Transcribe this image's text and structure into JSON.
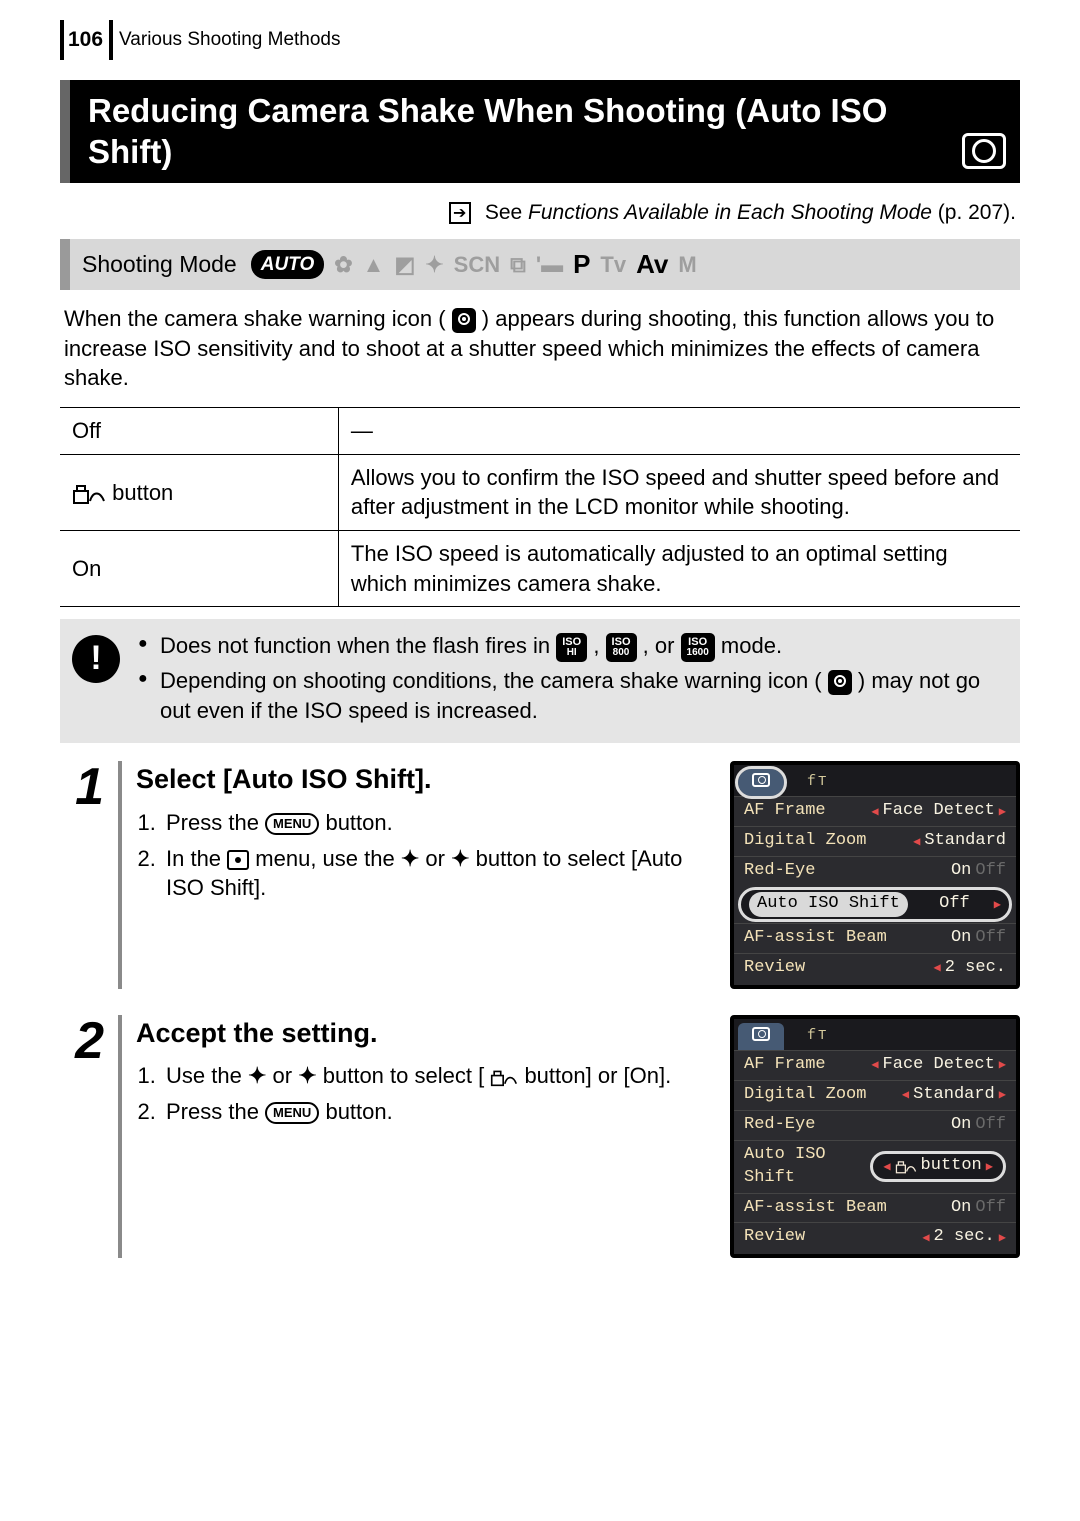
{
  "page": {
    "number": "106",
    "breadcrumb": "Various Shooting Methods"
  },
  "section": {
    "title": "Reducing Camera Shake When Shooting (Auto ISO Shift)"
  },
  "reference": {
    "prefix_plain": "See ",
    "link_text": "Functions Available in Each Shooting Mode",
    "page_ref": " (p. 207)."
  },
  "shooting_mode": {
    "label": "Shooting Mode",
    "auto": "AUTO",
    "scn": "SCN",
    "modes_active": {
      "p": "P",
      "av": "Av"
    },
    "modes_inactive": {
      "tv": "Tv",
      "m": "M"
    }
  },
  "intro": {
    "part1": "When the camera shake warning icon (",
    "part2": ") appears during shooting, this function allows you to increase ISO sensitivity and to shoot at a shutter speed which minimizes the effects of camera shake."
  },
  "table": {
    "rows": [
      {
        "label": "Off",
        "desc": "—"
      },
      {
        "label_suffix": " button",
        "desc": "Allows you to confirm the ISO speed and shutter speed before and after adjustment in the LCD monitor while shooting."
      },
      {
        "label": "On",
        "desc": "The ISO speed is automatically adjusted to an optimal setting which minimizes camera shake."
      }
    ]
  },
  "warning": {
    "b1a": "Does not function when the flash fires in ",
    "b1b": ", ",
    "b1c": ", or ",
    "b1d": " mode.",
    "iso_hi": "HI",
    "iso_800": "800",
    "iso_1600": "1600",
    "b2a": "Depending on shooting conditions, the camera shake warning icon (",
    "b2b": ") may not go out even if the ISO speed is increased."
  },
  "steps": [
    {
      "num": "1",
      "title": "Select [Auto ISO Shift].",
      "items": {
        "i1a": "Press the ",
        "i1b": " button.",
        "i2a": "In the ",
        "i2b": " menu, use the ",
        "i2c": " or ",
        "i2d": " button to select [Auto ISO Shift]."
      },
      "menu_label": "MENU",
      "lcd": {
        "rows": [
          {
            "label": "AF Frame",
            "val": "Face Detect"
          },
          {
            "label": "Digital Zoom",
            "val": "Standard"
          },
          {
            "label": "Red-Eye",
            "val_on": "On",
            "val_off": "Off"
          },
          {
            "label": "Auto ISO Shift",
            "val": "Off",
            "ring": true
          },
          {
            "label": "AF-assist Beam",
            "val_on": "On",
            "val_off": "Off"
          },
          {
            "label": "Review",
            "val": "2 sec."
          }
        ]
      }
    },
    {
      "num": "2",
      "title": "Accept the setting.",
      "items": {
        "i1a": "Use the ",
        "i1b": " or ",
        "i1c": " button to select [",
        "i1d": " button] or [On].",
        "i2a": "Press the ",
        "i2b": " button."
      },
      "menu_label": "MENU",
      "lcd": {
        "rows": [
          {
            "label": "AF Frame",
            "val": "Face Detect"
          },
          {
            "label": "Digital Zoom",
            "val": "Standard"
          },
          {
            "label": "Red-Eye",
            "val_on": "On",
            "val_off": "Off"
          },
          {
            "label": "Auto ISO Shift",
            "val": "button",
            "ring_right": true
          },
          {
            "label": "AF-assist Beam",
            "val_on": "On",
            "val_off": "Off"
          },
          {
            "label": "Review",
            "val": "2 sec."
          }
        ]
      }
    }
  ]
}
